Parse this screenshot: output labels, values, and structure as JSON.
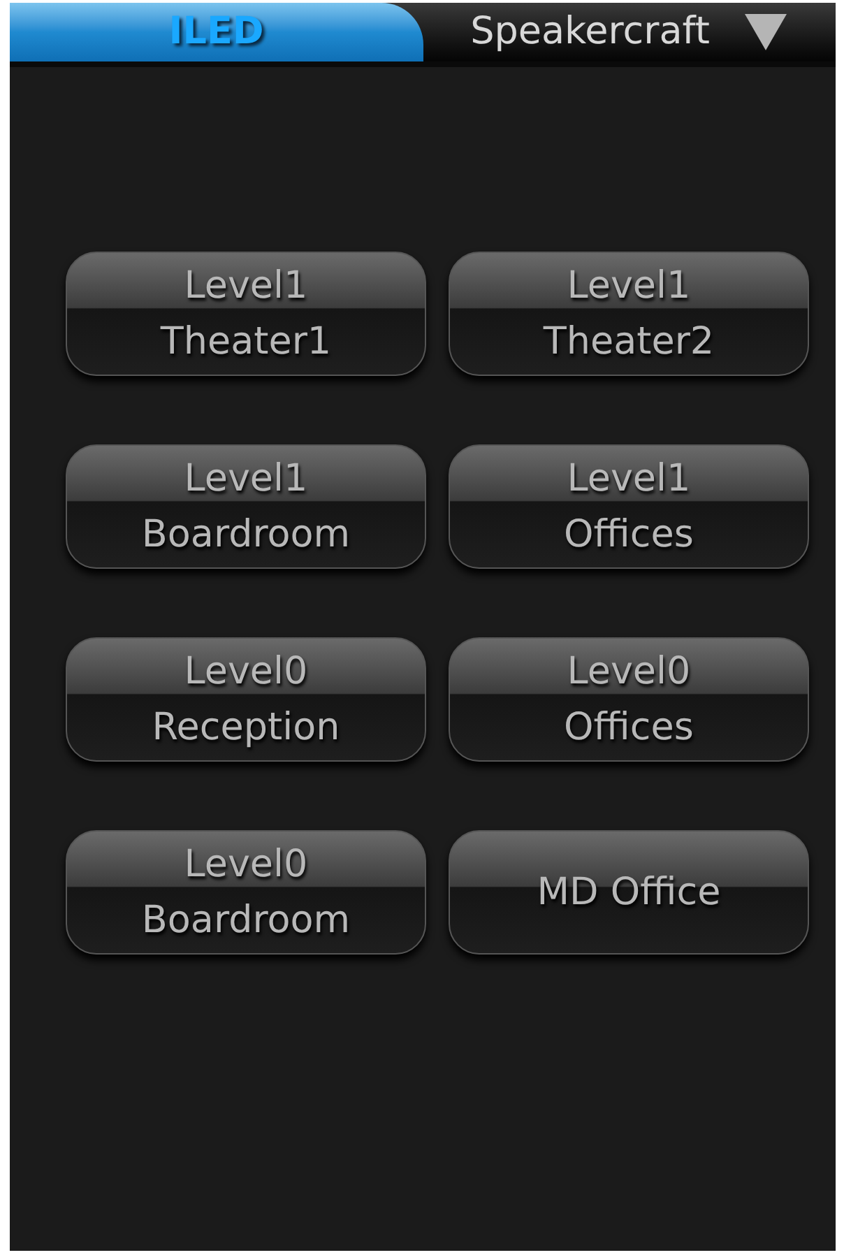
{
  "tabs": [
    {
      "label": "ILED",
      "selected": true
    },
    {
      "label": "Speakercraft",
      "selected": false,
      "dropdown": true
    }
  ],
  "rooms": [
    {
      "lines": [
        "Level1",
        "Theater1"
      ]
    },
    {
      "lines": [
        "Level1",
        "Theater2"
      ]
    },
    {
      "lines": [
        "Level1",
        "Boardroom"
      ]
    },
    {
      "lines": [
        "Level1",
        "Offices"
      ]
    },
    {
      "lines": [
        "Level0",
        "Reception"
      ]
    },
    {
      "lines": [
        "Level0",
        "Offices"
      ]
    },
    {
      "lines": [
        "Level0",
        "Boardroom"
      ]
    },
    {
      "lines": [
        "MD Office"
      ]
    }
  ]
}
